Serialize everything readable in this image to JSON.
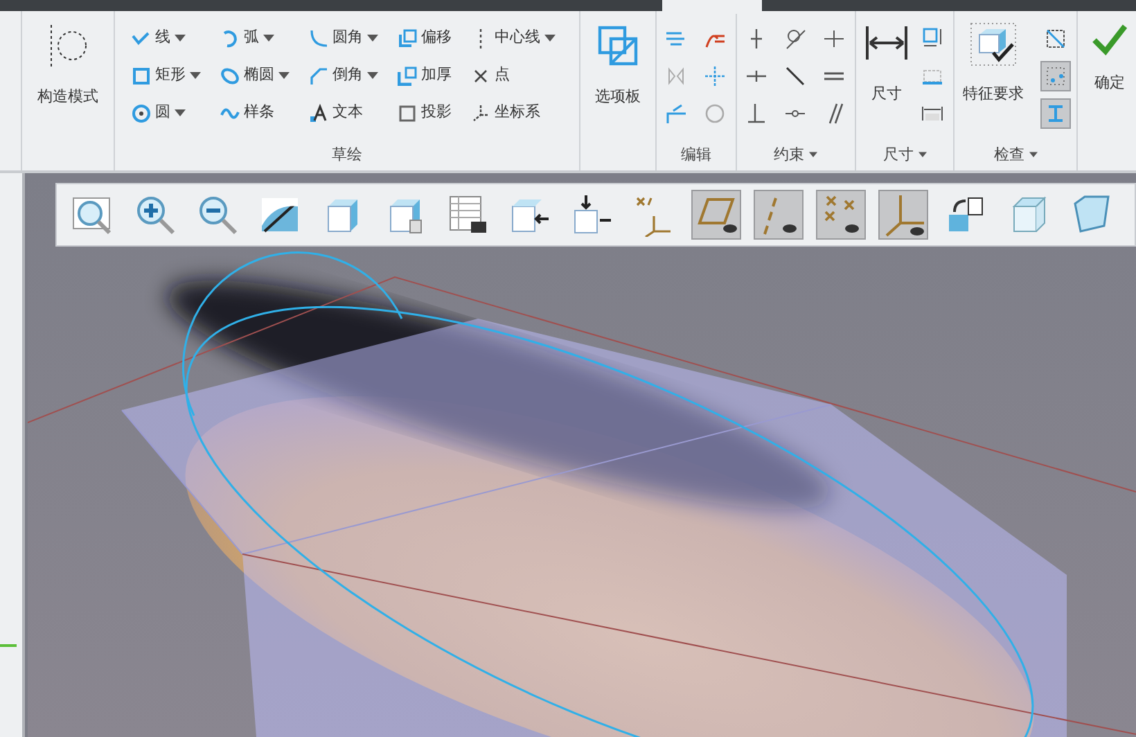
{
  "ribbon": {
    "construction_mode": {
      "label": "构造模式"
    },
    "sketch": {
      "label": "草绘",
      "tools": [
        {
          "label": "线",
          "dropdown": true
        },
        {
          "label": "弧",
          "dropdown": true
        },
        {
          "label": "圆角",
          "dropdown": true
        },
        {
          "label": "偏移",
          "dropdown": false
        },
        {
          "label": "中心线",
          "dropdown": true
        },
        {
          "label": "矩形",
          "dropdown": true
        },
        {
          "label": "椭圆",
          "dropdown": true
        },
        {
          "label": "倒角",
          "dropdown": true
        },
        {
          "label": "加厚",
          "dropdown": false
        },
        {
          "label": "点",
          "dropdown": false
        },
        {
          "label": "圆",
          "dropdown": true
        },
        {
          "label": "样条",
          "dropdown": false
        },
        {
          "label": "文本",
          "dropdown": false
        },
        {
          "label": "投影",
          "dropdown": false
        },
        {
          "label": "坐标系",
          "dropdown": false
        }
      ]
    },
    "palette": {
      "label": "选项板"
    },
    "edit": {
      "label": "编辑"
    },
    "constrain": {
      "label": "约束",
      "dropdown": true
    },
    "dimension": {
      "label": "尺寸",
      "button": "尺寸",
      "dropdown": true
    },
    "inspect": {
      "label": "检查",
      "button": "特征要求",
      "dropdown": true,
      "tools": [
        {
          "selected": false
        },
        {
          "selected": true
        },
        {
          "selected": true
        }
      ]
    },
    "ok": {
      "label": "确定"
    }
  },
  "view_toolbar": [
    {
      "selected": false
    },
    {
      "selected": false
    },
    {
      "selected": false
    },
    {
      "selected": false
    },
    {
      "selected": false
    },
    {
      "selected": false
    },
    {
      "selected": false
    },
    {
      "selected": false
    },
    {
      "selected": false
    },
    {
      "selected": false
    },
    {
      "selected": true
    },
    {
      "selected": true
    },
    {
      "selected": true
    },
    {
      "selected": true
    },
    {
      "selected": false
    },
    {
      "selected": false
    },
    {
      "selected": false
    }
  ]
}
